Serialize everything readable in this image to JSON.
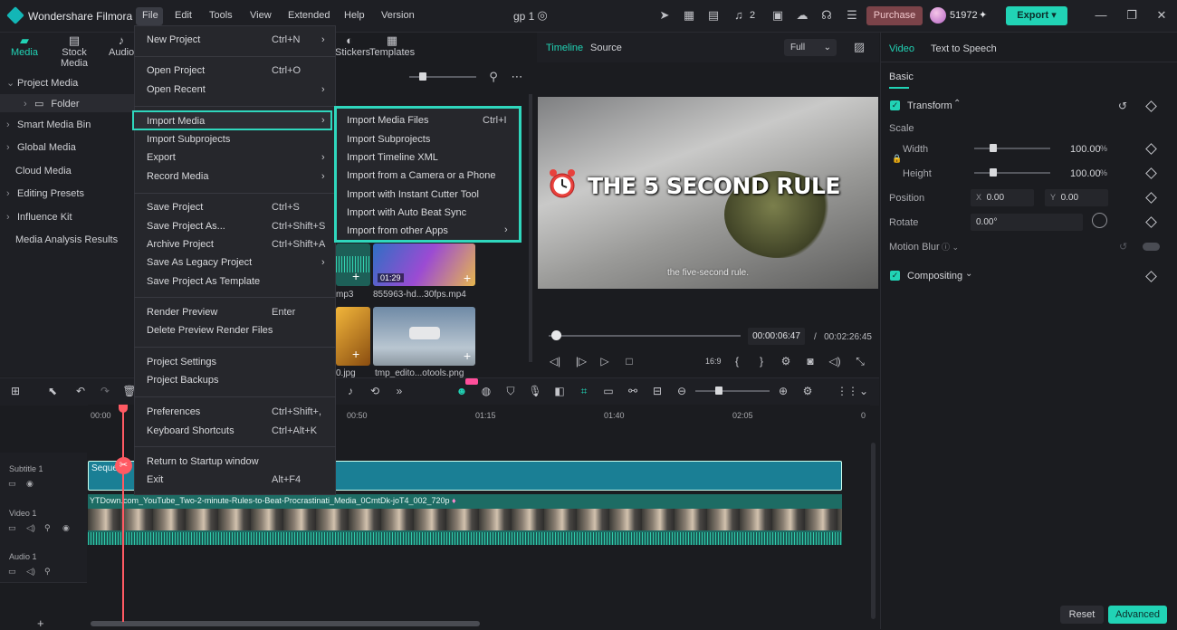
{
  "app": {
    "name": "Wondershare Filmora",
    "project": "gp 1",
    "credits": "51972"
  },
  "menubar": [
    "File",
    "Edit",
    "Tools",
    "View",
    "Extended",
    "Help",
    "Version"
  ],
  "titlebar": {
    "purchase": "Purchase",
    "export": "Export",
    "badge": "2"
  },
  "left_tabs": [
    "Media",
    "Stock Media",
    "Audio",
    "Stickers",
    "Templates"
  ],
  "left_tree": {
    "project_media": "Project Media",
    "folder": "Folder",
    "smart_media_bin": "Smart Media Bin",
    "global_media": "Global Media",
    "cloud_media": "Cloud Media",
    "editing_presets": "Editing Presets",
    "influence_kit": "Influence Kit",
    "media_analysis": "Media Analysis Results"
  },
  "media": {
    "thumb1_caption": "mp3",
    "thumb2_caption": "855963-hd...30fps.mp4",
    "thumb2_duration": "01:29",
    "thumb3_caption": "0.jpg",
    "thumb4_caption": "tmp_edito...otools.png"
  },
  "file_menu": {
    "new_project": "New Project",
    "new_project_sc": "Ctrl+N",
    "open_project": "Open Project",
    "open_project_sc": "Ctrl+O",
    "open_recent": "Open Recent",
    "import_media": "Import Media",
    "import_subprojects": "Import Subprojects",
    "export": "Export",
    "record_media": "Record Media",
    "save_project": "Save Project",
    "save_project_sc": "Ctrl+S",
    "save_project_as": "Save Project As...",
    "save_project_as_sc": "Ctrl+Shift+S",
    "archive_project": "Archive Project",
    "archive_project_sc": "Ctrl+Shift+A",
    "save_legacy": "Save As Legacy Project",
    "save_template": "Save Project As Template",
    "render_preview": "Render Preview",
    "render_preview_sc": "Enter",
    "delete_render": "Delete Preview Render Files",
    "project_settings": "Project Settings",
    "project_backups": "Project Backups",
    "preferences": "Preferences",
    "preferences_sc": "Ctrl+Shift+,",
    "keyboard_shortcuts": "Keyboard Shortcuts",
    "keyboard_shortcuts_sc": "Ctrl+Alt+K",
    "return_startup": "Return to Startup window",
    "exit": "Exit",
    "exit_sc": "Alt+F4"
  },
  "import_submenu": {
    "media_files": "Import Media Files",
    "media_files_sc": "Ctrl+I",
    "subprojects": "Import Subprojects",
    "timeline_xml": "Import Timeline XML",
    "camera_phone": "Import from a Camera or a Phone",
    "instant_cutter": "Import with Instant Cutter Tool",
    "auto_beat": "Import with Auto Beat Sync",
    "other_apps": "Import from other Apps"
  },
  "preview": {
    "tab_timeline": "Timeline",
    "tab_source": "Source",
    "quality": "Full",
    "headline": "THE 5 SECOND RULE",
    "subtitle": "the five-second rule.",
    "current_time": "00:00:06:47",
    "total_time": "00:02:26:45",
    "scrub_progress": 0.04
  },
  "properties": {
    "tab_video": "Video",
    "tab_tts": "Text to Speech",
    "basic": "Basic",
    "transform": "Transform",
    "scale": "Scale",
    "width": "Width",
    "width_value": "100.00",
    "width_unit": "%",
    "height": "Height",
    "height_value": "100.00",
    "height_unit": "%",
    "position": "Position",
    "x_label": "X",
    "x_value": "0.00",
    "y_label": "Y",
    "y_value": "0.00",
    "rotate": "Rotate",
    "rotate_value": "0.00°",
    "motion_blur": "Motion Blur",
    "compositing": "Compositing",
    "reset": "Reset",
    "advanced": "Advanced"
  },
  "timeline": {
    "ruler": [
      "00:00",
      "00:50",
      "01:15",
      "01:40",
      "02:05",
      "0"
    ],
    "tracks": {
      "subtitle": "Subtitle 1",
      "video": "Video 1",
      "audio": "Audio 1"
    },
    "subtitle_clip": "Seque",
    "video_clip": "YTDown.com_YouTube_Two-2-minute-Rules-to-Beat-Procrastinati_Media_0CmtDk-joT4_002_720p"
  },
  "colors": {
    "accent": "#21d3b5",
    "purchase": "#7b4349",
    "playhead": "#ff5a63"
  }
}
